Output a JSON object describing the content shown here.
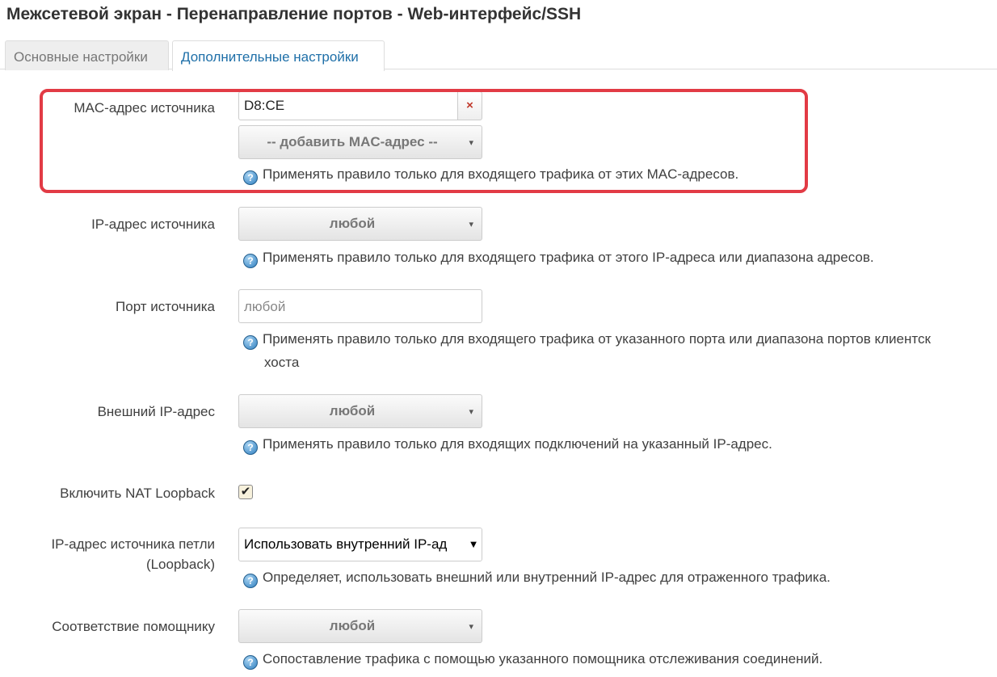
{
  "title": "Межсетевой экран - Перенаправление портов - Web-интерфейс/SSH",
  "tabs": {
    "basic": "Основные настройки",
    "advanced": "Дополнительные настройки"
  },
  "source_mac": {
    "label": "MAC-адрес источника",
    "value": "D8:CE",
    "remove_icon": "×",
    "add_select": "-- добавить MAC-адрес --",
    "hint": "Применять правило только для входящего трафика от этих MAC-адресов."
  },
  "source_ip": {
    "label": "IP-адрес источника",
    "value": "любой",
    "hint": "Применять правило только для входящего трафика от этого IP-адреса или диапазона адресов."
  },
  "source_port": {
    "label": "Порт источника",
    "placeholder": "любой",
    "hint_line1": "Применять правило только для входящего трафика от указанного порта или диапазона портов клиентск",
    "hint_line2": "хоста"
  },
  "external_ip": {
    "label": "Внешний IP-адрес",
    "value": "любой",
    "hint": "Применять правило только для входящих подключений на указанный IP-адрес."
  },
  "nat_loopback": {
    "label": "Включить NAT Loopback",
    "checked": true,
    "check_mark": "✔"
  },
  "loopback_source": {
    "label_line1": "IP-адрес источника петли",
    "label_line2": "(Loopback)",
    "value": "Использовать внутренний IP-ад",
    "hint": "Определяет, использовать внешний или внутренний IP-адрес для отраженного трафика."
  },
  "helper": {
    "label": "Соответствие помощнику",
    "value": "любой",
    "hint": "Сопоставление трафика с помощью указанного помощника отслеживания соединений."
  },
  "icons": {
    "help": "help-icon",
    "help_glyph": "?",
    "caret": "▾",
    "caret_plain": "▼"
  },
  "colors": {
    "highlight": "#e23b45",
    "active_tab": "#1e6fa8",
    "remove": "#c0392b"
  }
}
